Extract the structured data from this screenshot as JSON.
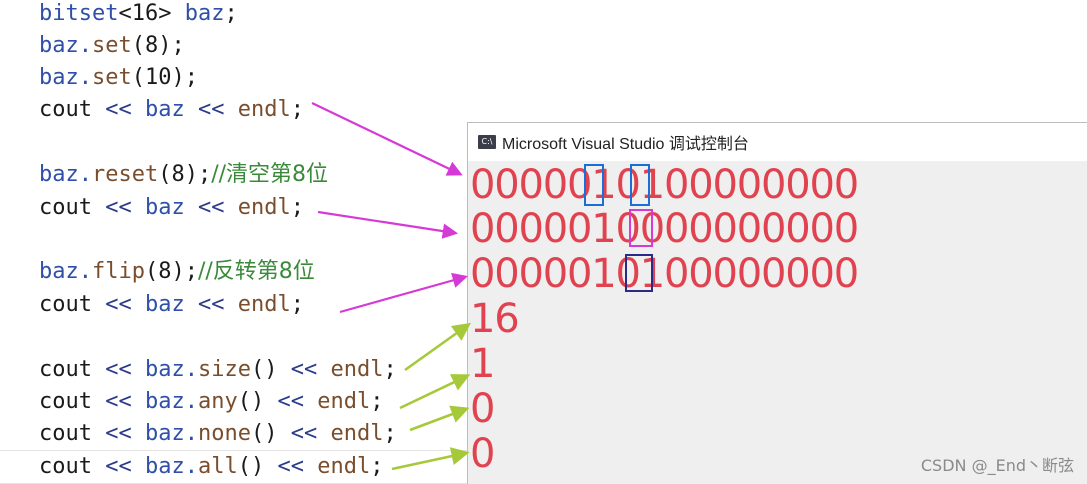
{
  "code": {
    "lines": [
      {
        "parts": [
          {
            "t": "bitset",
            "c": "kw"
          },
          {
            "t": "<16> ",
            "c": "txt"
          },
          {
            "t": "baz",
            "c": "kw"
          },
          {
            "t": ";",
            "c": "txt"
          }
        ]
      },
      {
        "parts": [
          {
            "t": "baz.",
            "c": "kw"
          },
          {
            "t": "set",
            "c": "fn"
          },
          {
            "t": "(8);",
            "c": "txt"
          }
        ]
      },
      {
        "parts": [
          {
            "t": "baz.",
            "c": "kw"
          },
          {
            "t": "set",
            "c": "fn"
          },
          {
            "t": "(10);",
            "c": "txt"
          }
        ]
      },
      {
        "parts": [
          {
            "t": "cout ",
            "c": "txt"
          },
          {
            "t": "<< ",
            "c": "op"
          },
          {
            "t": "baz ",
            "c": "kw"
          },
          {
            "t": "<< ",
            "c": "op"
          },
          {
            "t": "endl",
            "c": "fn"
          },
          {
            "t": ";",
            "c": "txt"
          }
        ]
      },
      {
        "parts": [
          {
            "t": "baz.",
            "c": "kw"
          },
          {
            "t": "reset",
            "c": "fn"
          },
          {
            "t": "(8);",
            "c": "txt"
          },
          {
            "t": "//清空第8位",
            "c": "cmt"
          }
        ]
      },
      {
        "parts": [
          {
            "t": "cout ",
            "c": "txt"
          },
          {
            "t": "<< ",
            "c": "op"
          },
          {
            "t": "baz ",
            "c": "kw"
          },
          {
            "t": "<< ",
            "c": "op"
          },
          {
            "t": "endl",
            "c": "fn"
          },
          {
            "t": ";",
            "c": "txt"
          }
        ]
      },
      {
        "parts": [
          {
            "t": "baz.",
            "c": "kw"
          },
          {
            "t": "flip",
            "c": "fn"
          },
          {
            "t": "(8);",
            "c": "txt"
          },
          {
            "t": "//反转第8位",
            "c": "cmt"
          }
        ]
      },
      {
        "parts": [
          {
            "t": "cout ",
            "c": "txt"
          },
          {
            "t": "<< ",
            "c": "op"
          },
          {
            "t": "baz ",
            "c": "kw"
          },
          {
            "t": "<< ",
            "c": "op"
          },
          {
            "t": "endl",
            "c": "fn"
          },
          {
            "t": ";",
            "c": "txt"
          }
        ]
      },
      {
        "parts": [
          {
            "t": "cout ",
            "c": "txt"
          },
          {
            "t": "<< ",
            "c": "op"
          },
          {
            "t": "baz.",
            "c": "kw"
          },
          {
            "t": "size",
            "c": "fn"
          },
          {
            "t": "() ",
            "c": "txt"
          },
          {
            "t": "<< ",
            "c": "op"
          },
          {
            "t": "endl",
            "c": "fn"
          },
          {
            "t": ";",
            "c": "txt"
          }
        ]
      },
      {
        "parts": [
          {
            "t": "cout ",
            "c": "txt"
          },
          {
            "t": "<< ",
            "c": "op"
          },
          {
            "t": "baz.",
            "c": "kw"
          },
          {
            "t": "any",
            "c": "fn"
          },
          {
            "t": "() ",
            "c": "txt"
          },
          {
            "t": "<< ",
            "c": "op"
          },
          {
            "t": "endl",
            "c": "fn"
          },
          {
            "t": ";",
            "c": "txt"
          }
        ]
      },
      {
        "parts": [
          {
            "t": "cout ",
            "c": "txt"
          },
          {
            "t": "<< ",
            "c": "op"
          },
          {
            "t": "baz.",
            "c": "kw"
          },
          {
            "t": "none",
            "c": "fn"
          },
          {
            "t": "() ",
            "c": "txt"
          },
          {
            "t": "<< ",
            "c": "op"
          },
          {
            "t": "endl",
            "c": "fn"
          },
          {
            "t": ";",
            "c": "txt"
          }
        ]
      },
      {
        "parts": [
          {
            "t": "cout ",
            "c": "txt"
          },
          {
            "t": "<< ",
            "c": "op"
          },
          {
            "t": "baz.",
            "c": "kw"
          },
          {
            "t": "all",
            "c": "fn"
          },
          {
            "t": "() ",
            "c": "txt"
          },
          {
            "t": "<< ",
            "c": "op"
          },
          {
            "t": "endl",
            "c": "fn"
          },
          {
            "t": ";",
            "c": "txt"
          }
        ]
      }
    ]
  },
  "console": {
    "title": "Microsoft Visual Studio 调试控制台",
    "icon": "console-app-icon",
    "icon_text": "C:\\",
    "output": [
      "0000010100000000",
      "0000010000000000",
      "0000010100000000",
      "16",
      "1",
      "0",
      "0"
    ]
  },
  "watermark": "CSDN @_End丶断弦",
  "colors": {
    "output": "#e0434f",
    "arrow_magenta": "#d63ad6",
    "arrow_green": "#a6c93a",
    "highlight_blue": "#1a6fd6",
    "highlight_pink": "#d63ad6",
    "highlight_navy": "#2a2a8a"
  }
}
